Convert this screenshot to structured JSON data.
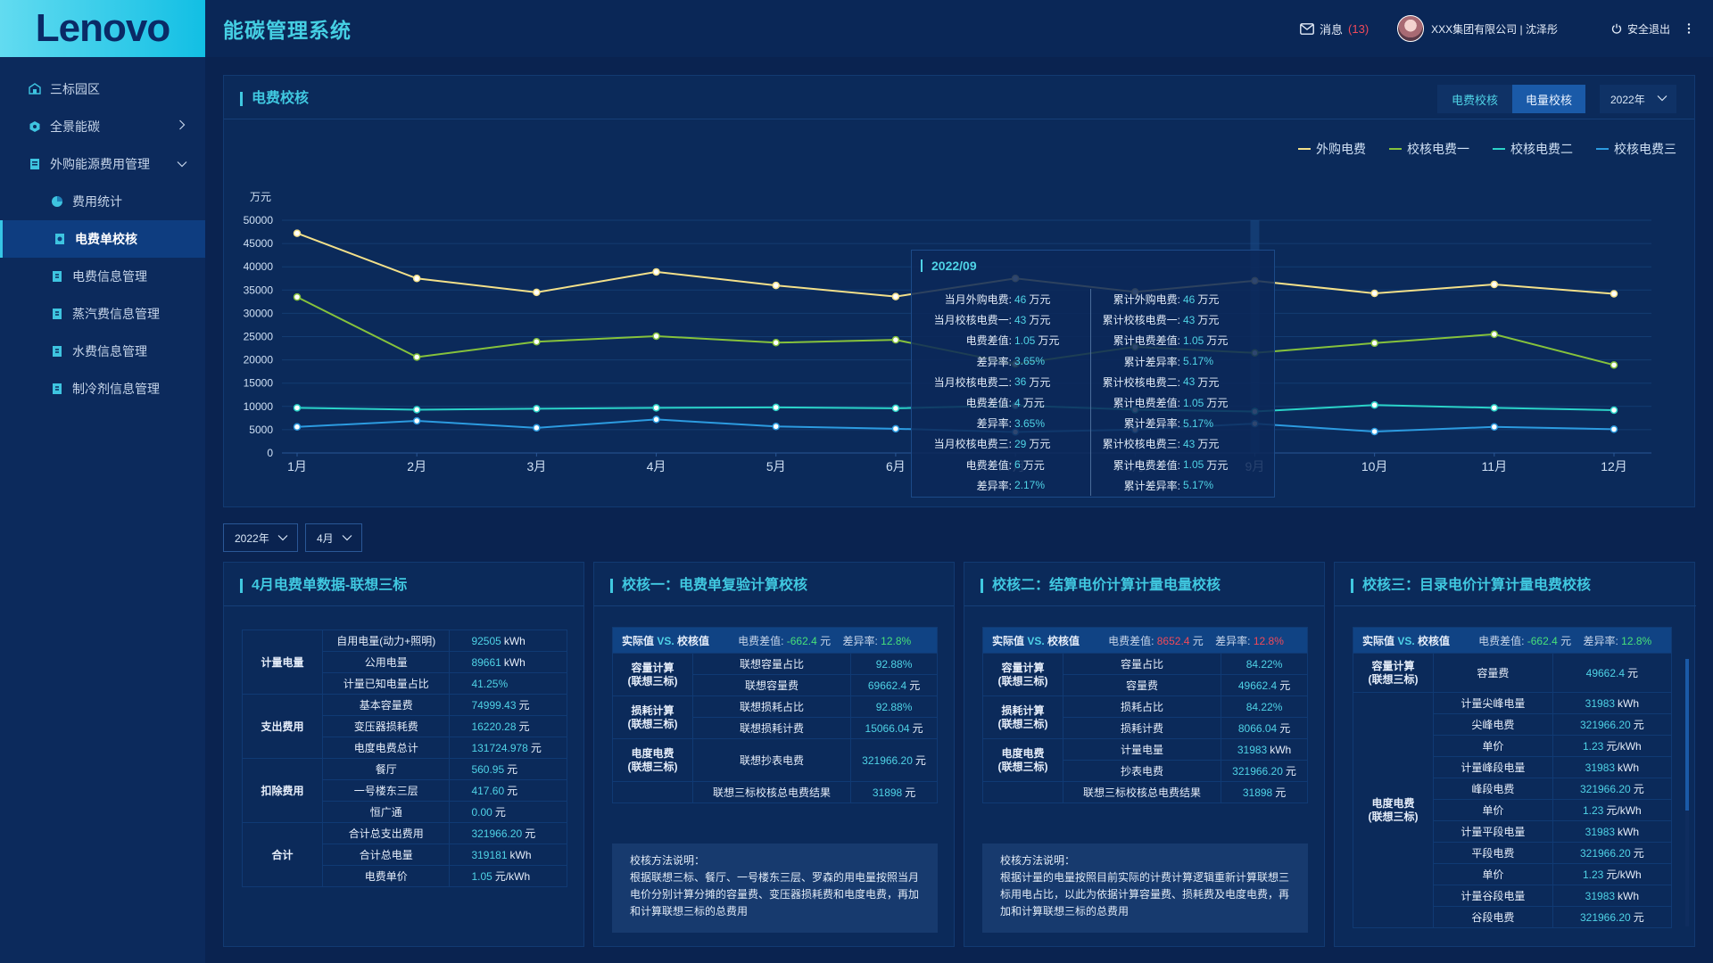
{
  "brand": {
    "logo_text": "Lenovo"
  },
  "header": {
    "system_title": "能碳管理系统",
    "messages_label": "消息",
    "messages_count": "(13)",
    "company_user": "XXX集团有限公司 | 沈泽彤",
    "logout_label": "安全退出"
  },
  "sidebar": {
    "items": [
      {
        "label": "三标园区",
        "icon": "campus-icon"
      },
      {
        "label": "全景能碳",
        "icon": "hexagon-icon"
      },
      {
        "label": "外购能源费用管理",
        "icon": "document-icon"
      }
    ],
    "sub_items": [
      {
        "label": "费用统计",
        "icon": "pie-icon"
      },
      {
        "label": "电费单校核",
        "icon": "check-icon",
        "active": true
      },
      {
        "label": "电费信息管理",
        "icon": "doc-icon"
      },
      {
        "label": "蒸汽费信息管理",
        "icon": "doc-icon"
      },
      {
        "label": "水费信息管理",
        "icon": "doc-icon"
      },
      {
        "label": "制冷剂信息管理",
        "icon": "doc-icon"
      }
    ]
  },
  "chart_panel": {
    "title": "电费校核",
    "tabs": [
      "电费校核",
      "电量校核"
    ],
    "year_select": "2022年",
    "tooltip": {
      "date": "2022/09",
      "left": [
        {
          "label": "当月外购电费:",
          "value": "46",
          "unit": "万元"
        },
        {
          "label": "当月校核电费一:",
          "value": "43",
          "unit": "万元"
        },
        {
          "label": "电费差值:",
          "value": "1.05",
          "unit": "万元"
        },
        {
          "label": "差异率:",
          "value": "3.65%",
          "unit": ""
        },
        {
          "label": "当月校核电费二:",
          "value": "36",
          "unit": "万元"
        },
        {
          "label": "电费差值:",
          "value": "4",
          "unit": "万元"
        },
        {
          "label": "差异率:",
          "value": "3.65%",
          "unit": ""
        },
        {
          "label": "当月校核电费三:",
          "value": "29",
          "unit": "万元"
        },
        {
          "label": "电费差值:",
          "value": "6",
          "unit": "万元"
        },
        {
          "label": "差异率:",
          "value": "2.17%",
          "unit": ""
        }
      ],
      "right": [
        {
          "label": "累计外购电费:",
          "value": "46",
          "unit": "万元"
        },
        {
          "label": "累计校核电费一:",
          "value": "43",
          "unit": "万元"
        },
        {
          "label": "累计电费差值:",
          "value": "1.05",
          "unit": "万元"
        },
        {
          "label": "累计差异率:",
          "value": "5.17%",
          "unit": ""
        },
        {
          "label": "累计校核电费二:",
          "value": "43",
          "unit": "万元"
        },
        {
          "label": "累计电费差值:",
          "value": "1.05",
          "unit": "万元"
        },
        {
          "label": "累计差异率:",
          "value": "5.17%",
          "unit": ""
        },
        {
          "label": "累计校核电费三:",
          "value": "43",
          "unit": "万元"
        },
        {
          "label": "累计电费差值:",
          "value": "1.05",
          "unit": "万元"
        },
        {
          "label": "累计差异率:",
          "value": "5.17%",
          "unit": ""
        }
      ]
    }
  },
  "chart_data": {
    "type": "line",
    "ylabel": "万元",
    "ylim": [
      0,
      50000
    ],
    "yticks": [
      0,
      5000,
      10000,
      15000,
      20000,
      25000,
      30000,
      35000,
      40000,
      45000,
      50000
    ],
    "categories": [
      "1月",
      "2月",
      "3月",
      "4月",
      "5月",
      "6月",
      "7月",
      "8月",
      "9月",
      "10月",
      "11月",
      "12月"
    ],
    "highlight_category": "9月",
    "legend_position": "top-right",
    "series": [
      {
        "name": "外购电费",
        "color": "#f3e08a",
        "values": [
          47200,
          37500,
          34500,
          38900,
          36000,
          33600,
          37500,
          34600,
          37000,
          34300,
          36200,
          34200
        ]
      },
      {
        "name": "校核电费一",
        "color": "#86c23c",
        "values": [
          33500,
          20600,
          23900,
          25100,
          23700,
          24300,
          19100,
          22800,
          21500,
          23600,
          25500,
          18900
        ]
      },
      {
        "name": "校核电费二",
        "color": "#2bd3c8",
        "values": [
          9700,
          9300,
          9500,
          9700,
          9800,
          9600,
          10200,
          9300,
          8900,
          10300,
          9700,
          9200
        ]
      },
      {
        "name": "校核电费三",
        "color": "#2c9be0",
        "values": [
          5600,
          6900,
          5400,
          7200,
          5700,
          5200,
          4500,
          5000,
          6300,
          4600,
          5600,
          5100
        ]
      }
    ]
  },
  "filters": {
    "year": "2022年",
    "month": "4月"
  },
  "card1": {
    "title": "4月电费单数据-联想三标",
    "groups": [
      {
        "name": "计量电量",
        "rows": [
          {
            "label": "自用电量(动力+照明)",
            "value": "92505",
            "unit": "kWh"
          },
          {
            "label": "公用电量",
            "value": "89661",
            "unit": "kWh"
          },
          {
            "label": "计量已知电量占比",
            "value": "41.25%",
            "unit": ""
          }
        ]
      },
      {
        "name": "支出费用",
        "rows": [
          {
            "label": "基本容量费",
            "value": "74999.43",
            "unit": "元"
          },
          {
            "label": "变压器损耗费",
            "value": "16220.28",
            "unit": "元"
          },
          {
            "label": "电度电费总计",
            "value": "131724.978",
            "unit": "元"
          }
        ]
      },
      {
        "name": "扣除费用",
        "rows": [
          {
            "label": "餐厅",
            "value": "560.95",
            "unit": "元"
          },
          {
            "label": "一号楼东三层",
            "value": "417.60",
            "unit": "元"
          },
          {
            "label": "恒广通",
            "value": "0.00",
            "unit": "元"
          }
        ]
      },
      {
        "name": "合计",
        "rows": [
          {
            "label": "合计总支出费用",
            "value": "321966.20",
            "unit": "元"
          },
          {
            "label": "合计总电量",
            "value": "319181",
            "unit": "kWh"
          },
          {
            "label": "电费单价",
            "value": "1.05",
            "unit": "元/kWh"
          }
        ]
      }
    ]
  },
  "card2": {
    "title": "校核一：电费单复验计算校核",
    "header": {
      "label_a": "实际值",
      "vs": "VS.",
      "label_b": "校核值",
      "diff_label": "电费差值:",
      "diff_value": "-662.4",
      "diff_unit": "元",
      "rate_label": "差异率:",
      "rate_value": "12.8%"
    },
    "groups": [
      {
        "name": "容量计算\n(联想三标)",
        "rows": [
          {
            "label": "联想容量占比",
            "value": "92.88%",
            "unit": ""
          },
          {
            "label": "联想容量费",
            "value": "69662.4",
            "unit": "元"
          }
        ]
      },
      {
        "name": "损耗计算\n(联想三标)",
        "rows": [
          {
            "label": "联想损耗占比",
            "value": "92.88%",
            "unit": ""
          },
          {
            "label": "联想损耗计费",
            "value": "15066.04",
            "unit": "元"
          }
        ]
      },
      {
        "name": "电度电费\n(联想三标)",
        "rows": [
          {
            "label": "联想抄表电费",
            "value": "321966.20",
            "unit": "元"
          }
        ]
      }
    ],
    "total": {
      "label": "联想三标校核总电费结果",
      "value": "31898",
      "unit": "元"
    },
    "note_title": "校核方法说明：",
    "note_body": "根据联想三标、餐厅、一号楼东三层、罗森的用电量按照当月电价分别计算分摊的容量费、变压器损耗费和电度电费，再加和计算联想三标的总费用"
  },
  "card3": {
    "title": "校核二：结算电价计算计量电量校核",
    "header": {
      "label_a": "实际值",
      "vs": "VS.",
      "label_b": "校核值",
      "diff_label": "电费差值:",
      "diff_value": "8652.4",
      "diff_unit": "元",
      "rate_label": "差异率:",
      "rate_value": "12.8%"
    },
    "groups": [
      {
        "name": "容量计算\n(联想三标)",
        "rows": [
          {
            "label": "容量占比",
            "value": "84.22%",
            "unit": ""
          },
          {
            "label": "容量费",
            "value": "49662.4",
            "unit": "元"
          }
        ]
      },
      {
        "name": "损耗计算\n(联想三标)",
        "rows": [
          {
            "label": "损耗占比",
            "value": "84.22%",
            "unit": ""
          },
          {
            "label": "损耗计费",
            "value": "8066.04",
            "unit": "元"
          }
        ]
      },
      {
        "name": "电度电费\n(联想三标)",
        "rows": [
          {
            "label": "计量电量",
            "value": "31983",
            "unit": "kWh"
          },
          {
            "label": "抄表电费",
            "value": "321966.20",
            "unit": "元"
          }
        ]
      }
    ],
    "total": {
      "label": "联想三标校核总电费结果",
      "value": "31898",
      "unit": "元"
    },
    "note_title": "校核方法说明：",
    "note_body": "根据计量的电量按照目前实际的计费计算逻辑重新计算联想三标用电占比，以此为依据计算容量费、损耗费及电度电费，再加和计算联想三标的总费用"
  },
  "card4": {
    "title": "校核三：目录电价计算计量电费校核",
    "header": {
      "label_a": "实际值",
      "vs": "VS.",
      "label_b": "校核值",
      "diff_label": "电费差值:",
      "diff_value": "-662.4",
      "diff_unit": "元",
      "rate_label": "差异率:",
      "rate_value": "12.8%"
    },
    "groups": [
      {
        "name": "容量计算\n(联想三标)",
        "rows": [
          {
            "label": "容量费",
            "value": "49662.4",
            "unit": "元"
          }
        ]
      },
      {
        "name": "电度电费\n(联想三标)",
        "rows": [
          {
            "label": "计量尖峰电量",
            "value": "31983",
            "unit": "kWh"
          },
          {
            "label": "尖峰电费",
            "value": "321966.20",
            "unit": "元"
          },
          {
            "label": "单价",
            "value": "1.23",
            "unit": "元/kWh"
          },
          {
            "label": "计量峰段电量",
            "value": "31983",
            "unit": "kWh"
          },
          {
            "label": "峰段电费",
            "value": "321966.20",
            "unit": "元"
          },
          {
            "label": "单价",
            "value": "1.23",
            "unit": "元/kWh"
          },
          {
            "label": "计量平段电量",
            "value": "31983",
            "unit": "kWh"
          },
          {
            "label": "平段电费",
            "value": "321966.20",
            "unit": "元"
          },
          {
            "label": "单价",
            "value": "1.23",
            "unit": "元/kWh"
          },
          {
            "label": "计量谷段电量",
            "value": "31983",
            "unit": "kWh"
          },
          {
            "label": "谷段电费",
            "value": "321966.20",
            "unit": "元"
          }
        ]
      }
    ]
  }
}
